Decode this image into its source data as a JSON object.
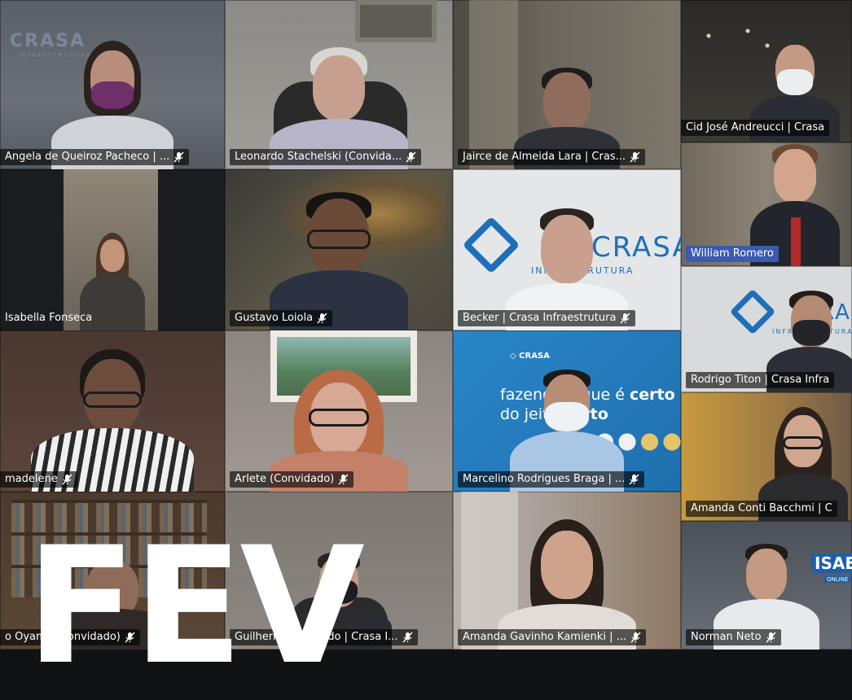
{
  "participants": [
    {
      "id": "angela",
      "label": "Angela de Queiroz Pacheco | ...",
      "muted": true
    },
    {
      "id": "leonardo",
      "label": "Leonardo Stachelski (Convida...",
      "muted": true
    },
    {
      "id": "jairce",
      "label": "Jairce de Almeida Lara | Cras...",
      "muted": true
    },
    {
      "id": "cid",
      "label": "Cid José Andreucci | Crasa",
      "muted": false
    },
    {
      "id": "isabella",
      "label": "Isabella Fonseca",
      "muted": false
    },
    {
      "id": "gustavo",
      "label": "Gustavo Loiola",
      "muted": true
    },
    {
      "id": "becker",
      "label": "Becker | Crasa Infraestrutura",
      "muted": true
    },
    {
      "id": "william",
      "label": "William Romero",
      "muted": false
    },
    {
      "id": "rodrigo",
      "label": "Rodrigo Titon | Crasa Infra",
      "muted": false
    },
    {
      "id": "madelene",
      "label": "madelene",
      "muted": true
    },
    {
      "id": "arlete",
      "label": "Arlete (Convidado)",
      "muted": true
    },
    {
      "id": "marcelino",
      "label": "Marcelino Rodrigues Braga | ...",
      "muted": true
    },
    {
      "id": "amanda-conti",
      "label": "Amanda Conti Bacchmi | C",
      "muted": false
    },
    {
      "id": "oyama",
      "label": "o Oyama (Convidado)",
      "muted": true
    },
    {
      "id": "guilherme",
      "label": "Guilherme Machado | Crasa I...",
      "muted": true
    },
    {
      "id": "amanda-gavinho",
      "label": "Amanda Gavinho Kamienki | ...",
      "muted": true
    },
    {
      "id": "norman",
      "label": "Norman Neto",
      "muted": true
    }
  ],
  "backgrounds": {
    "crasa_logo_text": "CRASA",
    "crasa_logo_sub": "INFRAESTRUTURA",
    "becker_logo_text": "CRASA",
    "becker_logo_sub": "INFRAESTRUTURA",
    "rodrigo_logo_text": "CRASA",
    "rodrigo_logo_sub": "INFRAESTRUTURA",
    "banner_small_logo": "CRASA",
    "banner_line1": "fazendo o que é",
    "banner_line1_bold": "certo",
    "banner_line2": "do jeito",
    "banner_line2_bold": "certo",
    "isae_text": "ISAE",
    "isae_sub": "ONLINE"
  },
  "overlay": {
    "logo_text": "FEV"
  },
  "colors": {
    "tile_label_bg": "#000000",
    "label_text": "#ffffff",
    "crasa_blue": "#1e6fb8",
    "banner_blue": "#2a86c9",
    "app_bg": "#101214"
  }
}
